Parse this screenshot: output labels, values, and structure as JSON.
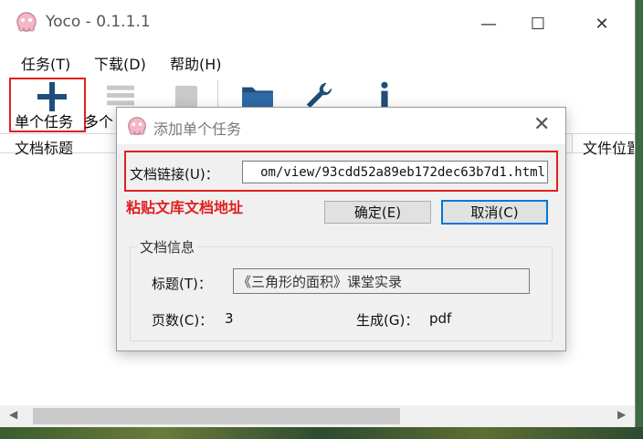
{
  "window": {
    "title": "Yoco - 0.1.1.1",
    "controls": {
      "minimize": "—",
      "maximize": "☐",
      "close": "✕"
    }
  },
  "menu": [
    "任务(T)",
    "下载(D)",
    "帮助(H)"
  ],
  "toolbar": {
    "items": [
      {
        "label": "单个任务",
        "icon": "plus-icon"
      },
      {
        "label": "多个",
        "icon": "list-icon"
      },
      {
        "label": "",
        "icon": "stop-icon"
      },
      {
        "label": "",
        "icon": "folder-icon"
      },
      {
        "label": "",
        "icon": "wrench-icon"
      },
      {
        "label": "",
        "icon": "info-icon"
      }
    ]
  },
  "columns": {
    "left": "文档标题",
    "right": "文件位置"
  },
  "dialog": {
    "title": "添加单个任务",
    "url_label": "文档链接(U)：",
    "url_value": "om/view/93cdd52a89eb172dec63b7d1.html",
    "hint": "粘贴文库文档地址",
    "ok_button": "确定(E)",
    "cancel_button": "取消(C)",
    "info_group": "文档信息",
    "title_label": "标题(T)：",
    "title_value": "《三角形的面积》课堂实录",
    "pages_label": "页数(C)：",
    "pages_value": "3",
    "format_label": "生成(G)：",
    "format_value": "pdf"
  },
  "colors": {
    "highlight": "#e02020",
    "accent": "#0078d7",
    "icon_blue": "#1f4e7a"
  }
}
